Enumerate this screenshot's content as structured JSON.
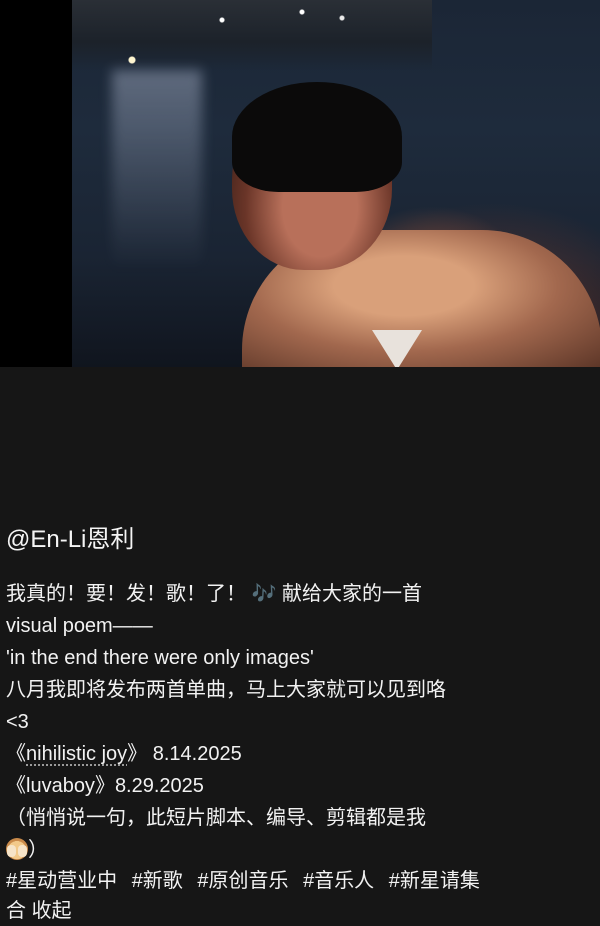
{
  "post": {
    "handle": "@En-Li恩利",
    "caption_lines": {
      "l1_text": "我真的！要！发！歌！了！",
      "l1_icon": "music-note-icon",
      "l1_icon_glyph": "🎶",
      "l1_tail": " 献给大家的一首",
      "l2": "visual poem——",
      "l3": "'in the end there were only images'",
      "l4": "八月我即将发布两首单曲，马上大家就可以见到咯",
      "l5": "<3",
      "l6_open": "《",
      "l6_title": "nihilistic joy",
      "l6_close": "》",
      "l6_date": " 8.14.2025",
      "l7_open": "《",
      "l7_title": "luvaboy",
      "l7_close": "》",
      "l7_date": "8.29.2025",
      "l8": "（悄悄说一句，此短片脚本、编导、剪辑都是我",
      "l9_icon": "see-no-evil-monkey-icon",
      "l9_tail": "）"
    },
    "hashtags": [
      "#星动营业中",
      "#新歌",
      "#原创音乐",
      "#音乐人",
      "#新星请集"
    ],
    "hashtag_wrap": "合",
    "collapse_label": "收起"
  }
}
